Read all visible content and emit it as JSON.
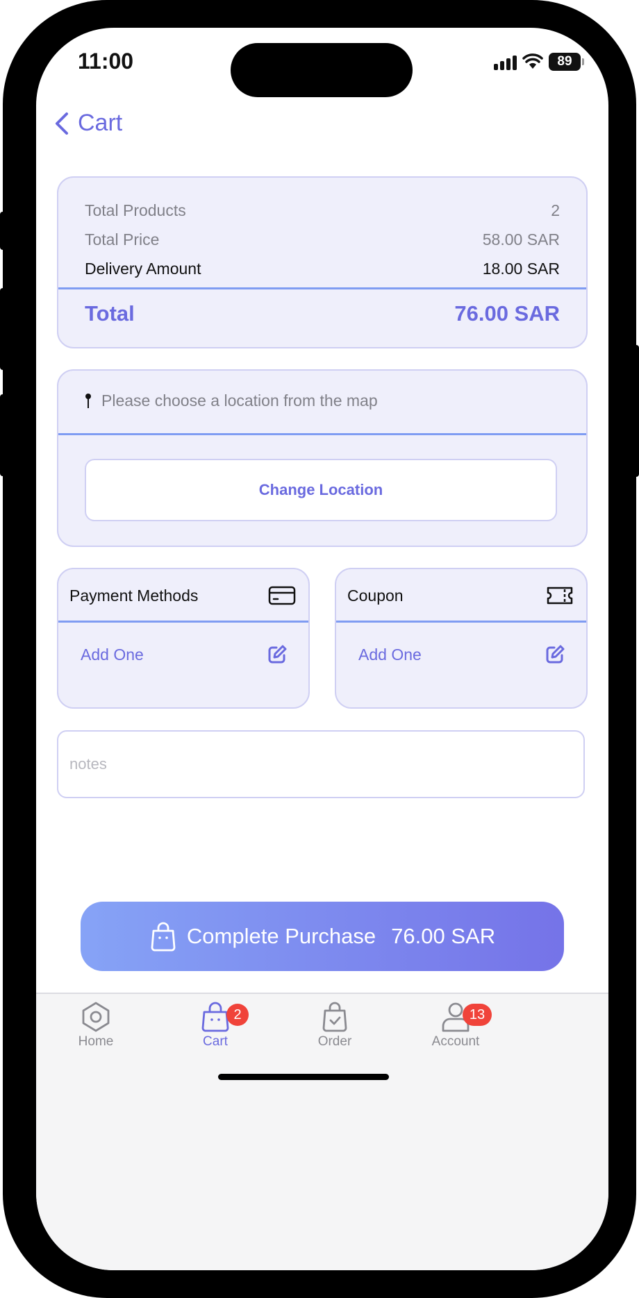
{
  "status": {
    "time": "11:00",
    "battery": "89"
  },
  "nav": {
    "title": "Cart"
  },
  "summary": {
    "total_products_label": "Total Products",
    "total_products_value": "2",
    "total_price_label": "Total Price",
    "total_price_value": "58.00 SAR",
    "delivery_label": "Delivery Amount",
    "delivery_value": "18.00 SAR",
    "total_label": "Total",
    "total_value": "76.00 SAR"
  },
  "location": {
    "prompt": "Please choose a location from the map",
    "change_label": "Change Location"
  },
  "payment": {
    "title": "Payment Methods",
    "add_label": "Add One"
  },
  "coupon": {
    "title": "Coupon",
    "add_label": "Add One"
  },
  "notes": {
    "placeholder": "notes",
    "value": ""
  },
  "purchase": {
    "label": "Complete Purchase",
    "amount": "76.00 SAR"
  },
  "tabs": [
    {
      "label": "Home",
      "icon": "home-icon",
      "badge": ""
    },
    {
      "label": "Cart",
      "icon": "bag-icon",
      "badge": "2"
    },
    {
      "label": "Order",
      "icon": "order-bag-icon",
      "badge": ""
    },
    {
      "label": "Account",
      "icon": "account-icon",
      "badge": "13"
    }
  ],
  "colors": {
    "accent": "#6a6adf",
    "divider": "#7f9cf2",
    "card_bg": "#efeffb",
    "badge": "#f0433a"
  }
}
